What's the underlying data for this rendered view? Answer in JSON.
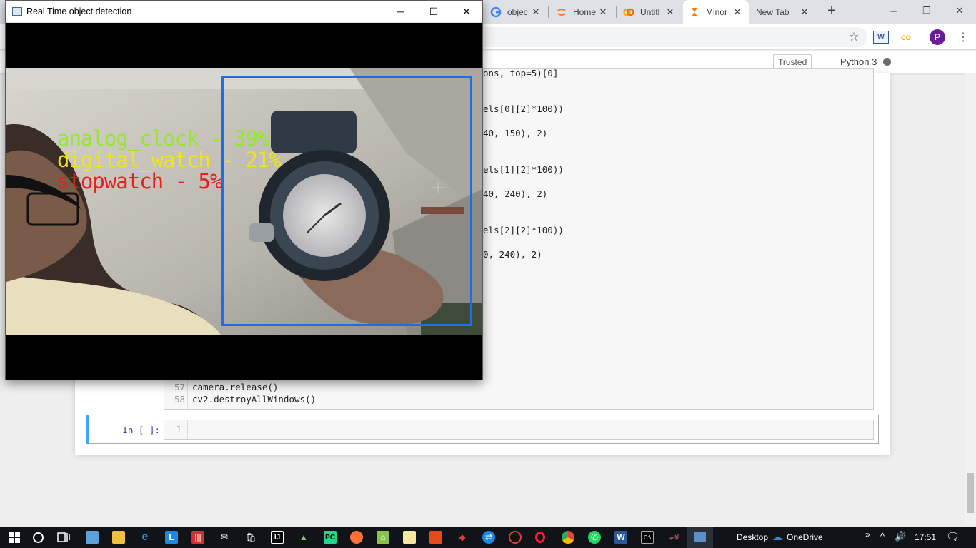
{
  "browser": {
    "tabs": [
      {
        "label": "objec",
        "favicon": "google-icon",
        "color": "#4285f4"
      },
      {
        "label": "Home",
        "favicon": "jupyter-icon",
        "color": "#f37726"
      },
      {
        "label": "Untitl",
        "favicon": "colab-icon",
        "color": "#f9ab00"
      },
      {
        "label": "Minor",
        "favicon": "hourglass-icon",
        "color": "#f57c00"
      },
      {
        "label": "New Tab",
        "favicon": "",
        "color": ""
      }
    ],
    "new_tab": "+",
    "window_controls": {
      "minimize": "─",
      "restore": "❐",
      "close": "✕"
    },
    "toolbar": {
      "star": "☆",
      "ext1": "W",
      "ext2": "co",
      "profile": "P",
      "menu": "⋮"
    }
  },
  "notebook": {
    "trusted_label": "Trusted",
    "kernel_name": "Python 3",
    "code_fragments": [
      {
        "text": "ons, top=5)[0]"
      },
      {
        "text": "els[0][2]*100))"
      },
      {
        "text": "40, 150), 2)"
      },
      {
        "text": "els[1][2]*100))"
      },
      {
        "text": "40, 240), 2)"
      },
      {
        "text": "els[2][2]*100))"
      },
      {
        "text": "0, 240), 2)"
      }
    ],
    "code_lines": [
      {
        "num": "57",
        "text": "camera.release()"
      },
      {
        "num": "58",
        "text": "cv2.destroyAllWindows()"
      }
    ],
    "empty_cell": {
      "prompt": "In [ ]:",
      "line_num": "1"
    }
  },
  "cv_window": {
    "title": "Real Time object detection",
    "controls": {
      "minimize": "─",
      "maximize": "☐",
      "close": "✕"
    },
    "detections": [
      {
        "label": "analog_clock - 39%",
        "color": "#96e632"
      },
      {
        "label": "digital_watch - 21%",
        "color": "#f0e614"
      },
      {
        "label": "stopwatch - 5%",
        "color": "#e81e1e"
      }
    ],
    "box_color": "#1a6fe8"
  },
  "taskbar": {
    "desktop_label": "Desktop",
    "onedrive_label": "OneDrive",
    "time": "17:51",
    "overflow": "»"
  }
}
